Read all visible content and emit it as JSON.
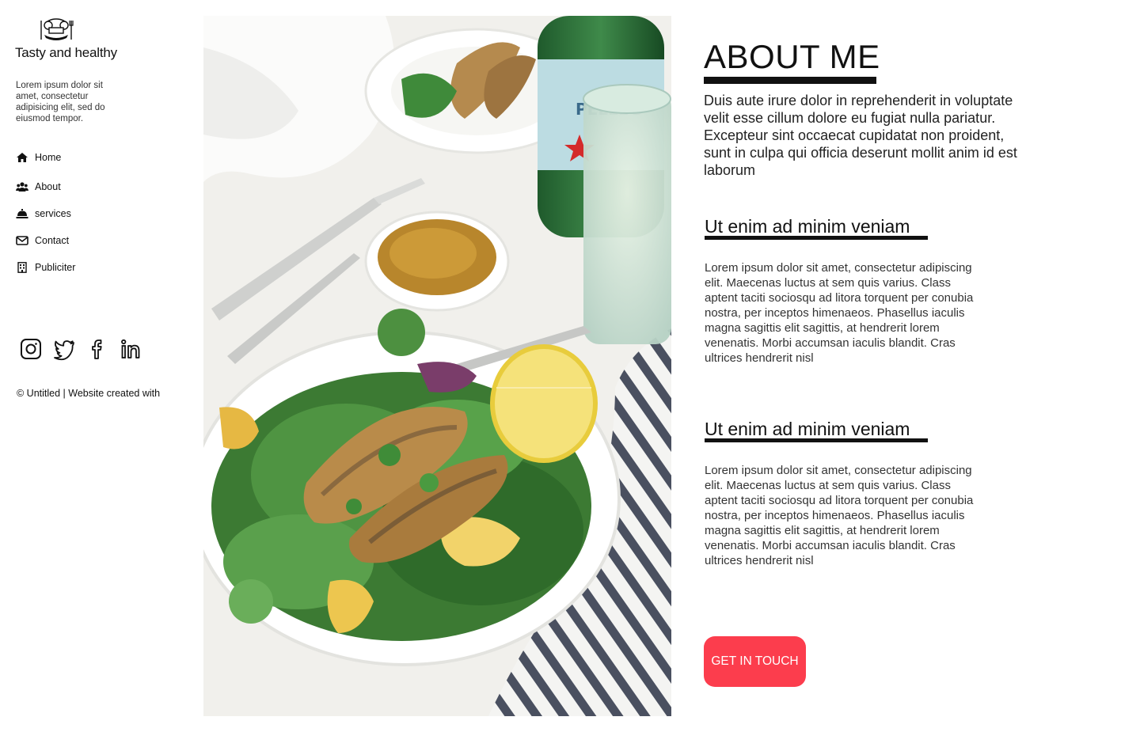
{
  "brand": {
    "name": "Tasty and healthy",
    "tagline": "Lorem ipsum dolor sit amet, consectetur adipisicing elit, sed do eiusmod tempor."
  },
  "nav": {
    "items": [
      {
        "label": "Home",
        "icon": "home-icon"
      },
      {
        "label": "About",
        "icon": "users-icon"
      },
      {
        "label": "services",
        "icon": "service-bell-icon"
      },
      {
        "label": "Contact",
        "icon": "envelope-icon"
      },
      {
        "label": "Publiciter",
        "icon": "building-icon"
      }
    ]
  },
  "social": [
    "instagram-icon",
    "twitter-icon",
    "facebook-icon",
    "linkedin-icon"
  ],
  "footer": {
    "copyright": "© Untitled | Website created with"
  },
  "main": {
    "title": "ABOUT ME",
    "intro": "Duis aute irure dolor in reprehenderit in voluptate velit esse cillum dolore eu fugiat nulla pariatur. Excepteur sint occaecat cupidatat non proident, sunt in culpa qui officia deserunt mollit anim id est laborum",
    "sections": [
      {
        "heading": "Ut enim ad minim veniam",
        "body": "Lorem ipsum dolor sit amet, consectetur adipiscing elit. Maecenas luctus at sem quis varius. Class aptent taciti sociosqu ad litora torquent per conubia nostra, per inceptos himenaeos. Phasellus iaculis magna sagittis elit sagittis, at hendrerit lorem venenatis. Morbi accumsan iaculis blandit. Cras ultrices hendrerit nisl"
      },
      {
        "heading": "Ut enim ad minim veniam",
        "body": "Lorem ipsum dolor sit amet, consectetur adipiscing elit. Maecenas luctus at sem quis varius. Class aptent taciti sociosqu ad litora torquent per conubia nostra, per inceptos himenaeos. Phasellus iaculis magna sagittis elit sagittis, at hendrerit lorem venenatis. Morbi accumsan iaculis blandit. Cras ultrices hendrerit nisl"
      }
    ],
    "cta_label": "GET IN TOUCH"
  },
  "colors": {
    "accent": "#fc3d4d",
    "text": "#111111",
    "background": "#ffffff"
  }
}
